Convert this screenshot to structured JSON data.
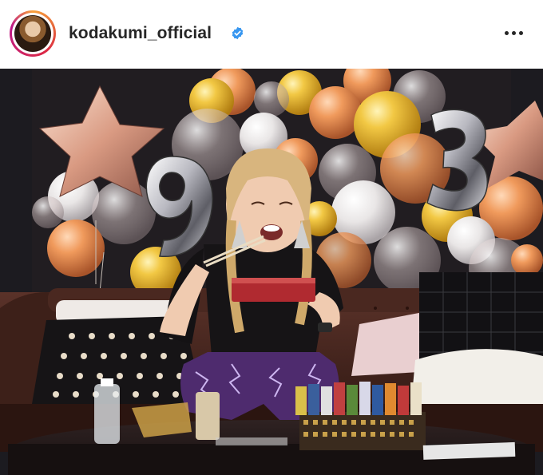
{
  "header": {
    "username": "kodakumi_official",
    "avatar_icon": "profile-avatar",
    "verified_icon": "verified-badge-icon",
    "more_icon": "more-options-icon",
    "verified_color": "#3897f0"
  },
  "post": {
    "image_alt": "Birthday celebration photo with balloons and number 93 foil balloons",
    "balloon_numbers": [
      "9",
      "3"
    ]
  }
}
